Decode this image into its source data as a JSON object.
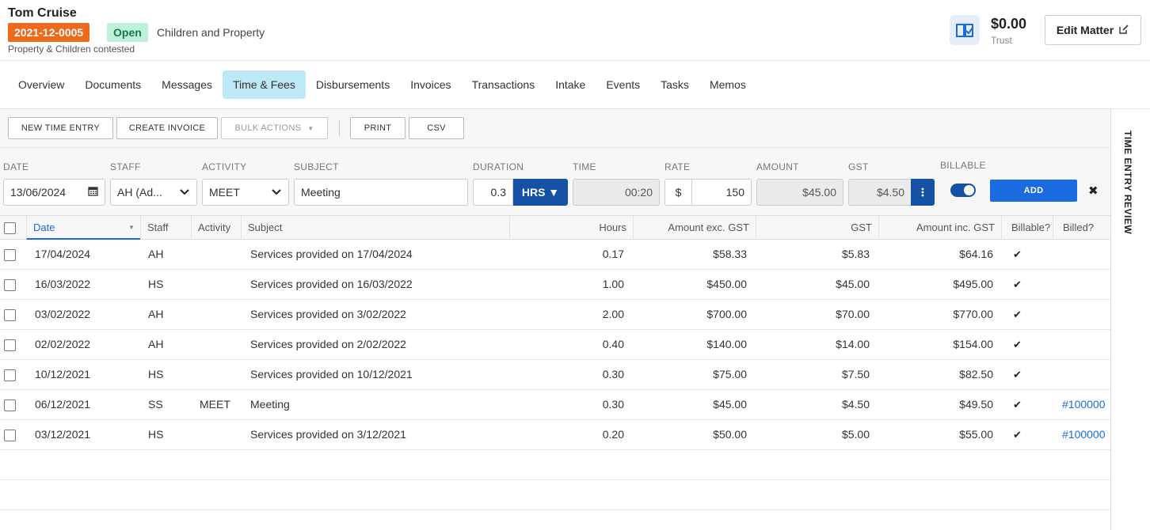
{
  "header": {
    "client_name": "Tom Cruise",
    "matter_number": "2021-12-0005",
    "status": "Open",
    "matter_type": "Children and Property",
    "description": "Property & Children contested",
    "trust_amount": "$0.00",
    "trust_label": "Trust",
    "edit_label": "Edit Matter"
  },
  "tabs": [
    "Overview",
    "Documents",
    "Messages",
    "Time & Fees",
    "Disbursements",
    "Invoices",
    "Transactions",
    "Intake",
    "Events",
    "Tasks",
    "Memos"
  ],
  "active_tab": "Time & Fees",
  "toolbar": {
    "new_time_entry": "NEW TIME ENTRY",
    "create_invoice": "CREATE INVOICE",
    "bulk_actions": "BULK ACTIONS",
    "print": "PRINT",
    "csv": "CSV"
  },
  "entry_form": {
    "labels": {
      "date": "DATE",
      "staff": "STAFF",
      "activity": "ACTIVITY",
      "subject": "SUBJECT",
      "duration": "DURATION",
      "time": "TIME",
      "rate": "RATE",
      "amount": "AMOUNT",
      "gst": "GST",
      "billable": "BILLABLE"
    },
    "date": "13/06/2024",
    "staff": "AH (Ad...",
    "activity": "MEET",
    "subject": "Meeting",
    "duration": "0.3",
    "duration_unit": "HRS ▼",
    "time": "00:20",
    "rate_currency": "$",
    "rate": "150",
    "amount": "$45.00",
    "gst": "$4.50",
    "billable": true,
    "add_label": "ADD",
    "close_label": "✖"
  },
  "table": {
    "columns": {
      "date": "Date",
      "staff": "Staff",
      "activity": "Activity",
      "subject": "Subject",
      "hours": "Hours",
      "amount_ex": "Amount exc. GST",
      "gst": "GST",
      "amount_inc": "Amount inc. GST",
      "billable": "Billable?",
      "billed": "Billed?"
    },
    "rows": [
      {
        "date": "17/04/2024",
        "staff": "AH",
        "activity": "",
        "subject": "Services provided on 17/04/2024",
        "hours": "0.17",
        "amount_ex": "$58.33",
        "gst": "$5.83",
        "amount_inc": "$64.16",
        "billable": "✔",
        "billed": ""
      },
      {
        "date": "16/03/2022",
        "staff": "HS",
        "activity": "",
        "subject": "Services provided on 16/03/2022",
        "hours": "1.00",
        "amount_ex": "$450.00",
        "gst": "$45.00",
        "amount_inc": "$495.00",
        "billable": "✔",
        "billed": ""
      },
      {
        "date": "03/02/2022",
        "staff": "AH",
        "activity": "",
        "subject": "Services provided on 3/02/2022",
        "hours": "2.00",
        "amount_ex": "$700.00",
        "gst": "$70.00",
        "amount_inc": "$770.00",
        "billable": "✔",
        "billed": ""
      },
      {
        "date": "02/02/2022",
        "staff": "AH",
        "activity": "",
        "subject": "Services provided on 2/02/2022",
        "hours": "0.40",
        "amount_ex": "$140.00",
        "gst": "$14.00",
        "amount_inc": "$154.00",
        "billable": "✔",
        "billed": ""
      },
      {
        "date": "10/12/2021",
        "staff": "HS",
        "activity": "",
        "subject": "Services provided on 10/12/2021",
        "hours": "0.30",
        "amount_ex": "$75.00",
        "gst": "$7.50",
        "amount_inc": "$82.50",
        "billable": "✔",
        "billed": ""
      },
      {
        "date": "06/12/2021",
        "staff": "SS",
        "activity": "MEET",
        "subject": "Meeting",
        "hours": "0.30",
        "amount_ex": "$45.00",
        "gst": "$4.50",
        "amount_inc": "$49.50",
        "billable": "✔",
        "billed": "#100000"
      },
      {
        "date": "03/12/2021",
        "staff": "HS",
        "activity": "",
        "subject": "Services provided on 3/12/2021",
        "hours": "0.20",
        "amount_ex": "$50.00",
        "gst": "$5.00",
        "amount_inc": "$55.00",
        "billable": "✔",
        "billed": "#100000"
      }
    ]
  },
  "side_panel": {
    "label": "TIME ENTRY REVIEW"
  },
  "colors": {
    "matter_badge": "#ee6a1b",
    "status_badge": "#bff0d9",
    "active_tab": "#bde8f5",
    "primary": "#1552a6",
    "add_button": "#1a6be0"
  },
  "icons": {
    "trust": "book-check-icon",
    "edit": "edit-icon",
    "calendar": "calendar-icon",
    "chevron": "chevron-down-icon",
    "more": "vertical-dots-icon",
    "check": "check-icon",
    "close": "close-icon",
    "sort": "sort-down-icon"
  }
}
